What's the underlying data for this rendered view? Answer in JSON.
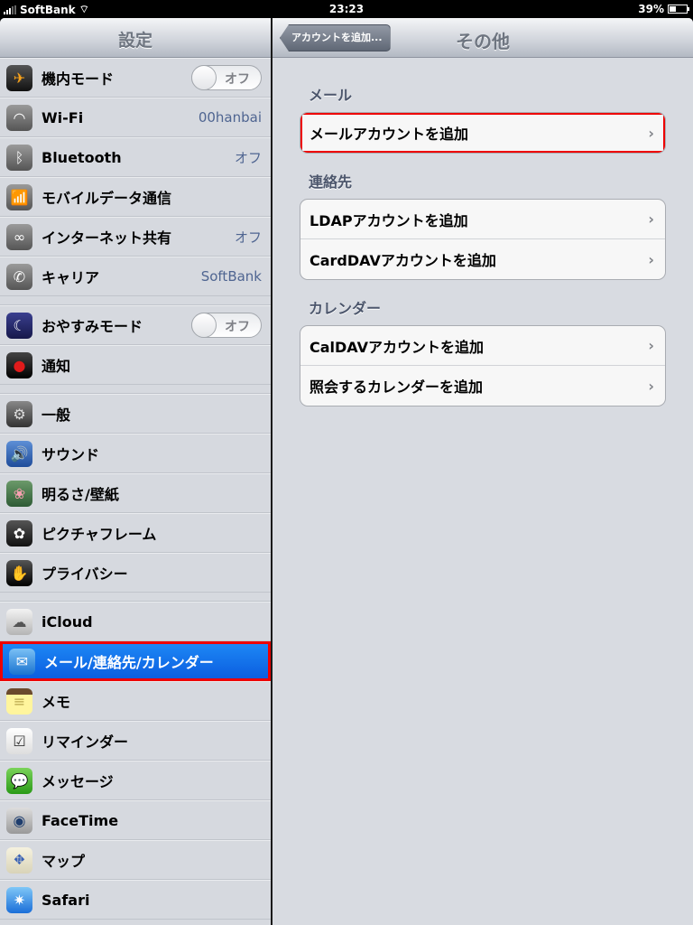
{
  "status_bar": {
    "carrier": "SoftBank",
    "time": "23:23",
    "battery": "39%",
    "battery_level": 0.39
  },
  "master": {
    "title": "設定",
    "groups": [
      [
        {
          "label": "機内モード",
          "icon": "airplane-icon",
          "toggle": "オフ"
        },
        {
          "label": "Wi-Fi",
          "icon": "wifi-icon",
          "value": "00hanbai"
        },
        {
          "label": "Bluetooth",
          "icon": "bluetooth-icon",
          "value": "オフ"
        },
        {
          "label": "モバイルデータ通信",
          "icon": "cellular-antenna-icon"
        },
        {
          "label": "インターネット共有",
          "icon": "personal-hotspot-icon",
          "value": "オフ"
        },
        {
          "label": "キャリア",
          "icon": "phone-icon",
          "value": "SoftBank"
        }
      ],
      [
        {
          "label": "おやすみモード",
          "icon": "moon-icon",
          "toggle": "オフ"
        },
        {
          "label": "通知",
          "icon": "notifications-icon"
        }
      ],
      [
        {
          "label": "一般",
          "icon": "gear-icon"
        },
        {
          "label": "サウンド",
          "icon": "speaker-icon"
        },
        {
          "label": "明るさ/壁紙",
          "icon": "flower-wallpaper-icon"
        },
        {
          "label": "ピクチャフレーム",
          "icon": "picture-frame-icon"
        },
        {
          "label": "プライバシー",
          "icon": "hand-privacy-icon"
        }
      ],
      [
        {
          "label": "iCloud",
          "icon": "cloud-icon"
        },
        {
          "label": "メール/連絡先/カレンダー",
          "icon": "mail-icon",
          "selected": true
        },
        {
          "label": "メモ",
          "icon": "notes-icon"
        },
        {
          "label": "リマインダー",
          "icon": "reminders-icon"
        },
        {
          "label": "メッセージ",
          "icon": "messages-icon"
        },
        {
          "label": "FaceTime",
          "icon": "facetime-camera-icon"
        },
        {
          "label": "マップ",
          "icon": "maps-icon"
        },
        {
          "label": "Safari",
          "icon": "compass-icon"
        }
      ]
    ]
  },
  "detail": {
    "back_label": "アカウントを追加...",
    "title": "その他",
    "sections": [
      {
        "header": "メール",
        "items": [
          {
            "label": "メールアカウントを追加",
            "highlight": true
          }
        ]
      },
      {
        "header": "連絡先",
        "items": [
          {
            "label": "LDAPアカウントを追加"
          },
          {
            "label": "CardDAVアカウントを追加"
          }
        ]
      },
      {
        "header": "カレンダー",
        "items": [
          {
            "label": "CalDAVアカウントを追加"
          },
          {
            "label": "照会するカレンダーを追加"
          }
        ]
      }
    ],
    "chevron": "›"
  },
  "icon_glyphs": {
    "airplane-icon": {
      "glyph": "✈",
      "bg": "linear-gradient(#555,#111)",
      "color": "#f7a21b"
    },
    "wifi-icon": {
      "glyph": "◠",
      "bg": "linear-gradient(#9a9a9a,#555)",
      "color": "#fff"
    },
    "bluetooth-icon": {
      "glyph": "ᛒ",
      "bg": "linear-gradient(#9a9a9a,#555)",
      "color": "#fff"
    },
    "cellular-antenna-icon": {
      "glyph": "📶",
      "bg": "linear-gradient(#9a9a9a,#555)",
      "color": "#fff"
    },
    "personal-hotspot-icon": {
      "glyph": "∞",
      "bg": "linear-gradient(#9a9a9a,#555)",
      "color": "#fff"
    },
    "phone-icon": {
      "glyph": "✆",
      "bg": "linear-gradient(#9a9a9a,#555)",
      "color": "#fff"
    },
    "moon-icon": {
      "glyph": "☾",
      "bg": "linear-gradient(#3a3f8f,#16184a)",
      "color": "#fff"
    },
    "notifications-icon": {
      "glyph": "●",
      "bg": "linear-gradient(#444,#000)",
      "color": "#e01b1b"
    },
    "gear-icon": {
      "glyph": "⚙",
      "bg": "linear-gradient(#888,#333)",
      "color": "#ddd"
    },
    "speaker-icon": {
      "glyph": "🔊",
      "bg": "linear-gradient(#5d8fd6,#1f4c9a)",
      "color": "#fff"
    },
    "flower-wallpaper-icon": {
      "glyph": "❀",
      "bg": "linear-gradient(#6b9a6a,#2e5b35)",
      "color": "#f7a0b0"
    },
    "picture-frame-icon": {
      "glyph": "✿",
      "bg": "linear-gradient(#555,#111)",
      "color": "#fff"
    },
    "hand-privacy-icon": {
      "glyph": "✋",
      "bg": "linear-gradient(#555,#000)",
      "color": "#fff"
    },
    "cloud-icon": {
      "glyph": "☁",
      "bg": "linear-gradient(#f3f3f3,#b5b5b5)",
      "color": "#555"
    },
    "mail-icon": {
      "glyph": "✉",
      "bg": "linear-gradient(#7ac0f5,#1b74d0)",
      "color": "#fff"
    },
    "notes-icon": {
      "glyph": "≡",
      "bg": "linear-gradient(#6b4a2c 25%,#fff59d 25%)",
      "color": "#b9a84e"
    },
    "reminders-icon": {
      "glyph": "☑",
      "bg": "linear-gradient(#fff,#ddd)",
      "color": "#333"
    },
    "messages-icon": {
      "glyph": "💬",
      "bg": "linear-gradient(#7ad35a,#2a9a17)",
      "color": "#fff"
    },
    "facetime-camera-icon": {
      "glyph": "◉",
      "bg": "linear-gradient(#ddd,#999)",
      "color": "#1f3e6e"
    },
    "maps-icon": {
      "glyph": "⛖",
      "bg": "linear-gradient(#f6f2df,#d9d3b8)",
      "color": "#3a62b5"
    },
    "compass-icon": {
      "glyph": "✷",
      "bg": "linear-gradient(#7fc7f7,#1a6ed8)",
      "color": "#fff"
    }
  }
}
